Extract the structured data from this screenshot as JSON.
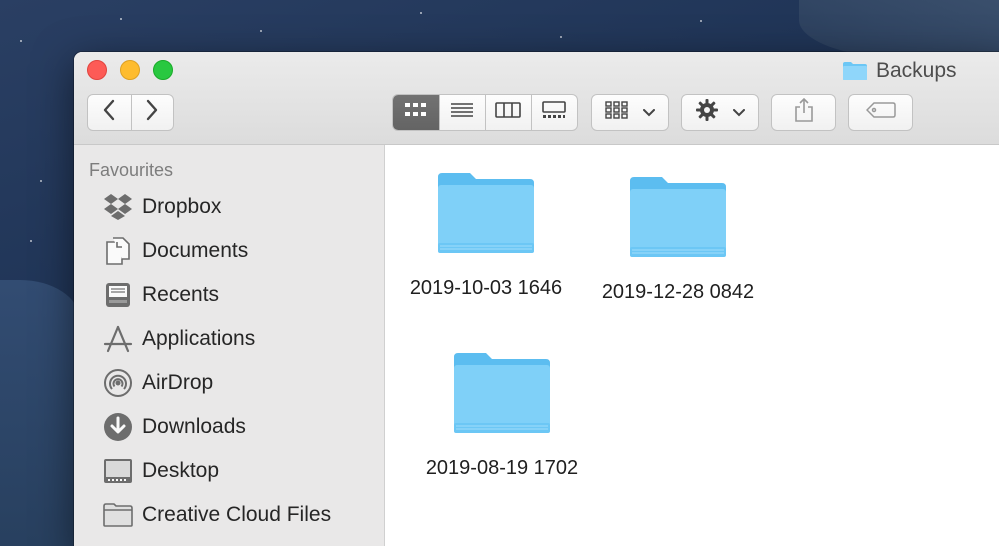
{
  "window": {
    "title": "Backups",
    "title_icon": "folder-icon"
  },
  "toolbar": {
    "back_icon": "chevron-left-icon",
    "forward_icon": "chevron-right-icon",
    "view_modes": [
      "icon-view-icon",
      "list-view-icon",
      "column-view-icon",
      "gallery-view-icon"
    ],
    "active_view": "icon-view-icon",
    "group_icon": "group-by-icon",
    "action_icon": "gear-icon",
    "share_icon": "share-icon",
    "tag_icon": "tag-icon"
  },
  "sidebar": {
    "heading": "Favourites",
    "items": [
      {
        "label": "Dropbox",
        "icon": "dropbox-icon"
      },
      {
        "label": "Documents",
        "icon": "documents-icon"
      },
      {
        "label": "Recents",
        "icon": "recents-icon"
      },
      {
        "label": "Applications",
        "icon": "applications-icon"
      },
      {
        "label": "AirDrop",
        "icon": "airdrop-icon"
      },
      {
        "label": "Downloads",
        "icon": "downloads-icon"
      },
      {
        "label": "Desktop",
        "icon": "desktop-icon"
      },
      {
        "label": "Creative Cloud Files",
        "icon": "folder-icon"
      }
    ]
  },
  "content": {
    "items": [
      {
        "name": "2019-10-03 1646"
      },
      {
        "name": "2019-12-28 0842"
      },
      {
        "name": "2019-08-19 1702"
      }
    ]
  },
  "colors": {
    "folder_blue": "#6cc7f5",
    "folder_blue_light": "#8fd6fa",
    "close": "#fd5b56",
    "minimize": "#febc2e",
    "maximize": "#29c840"
  }
}
